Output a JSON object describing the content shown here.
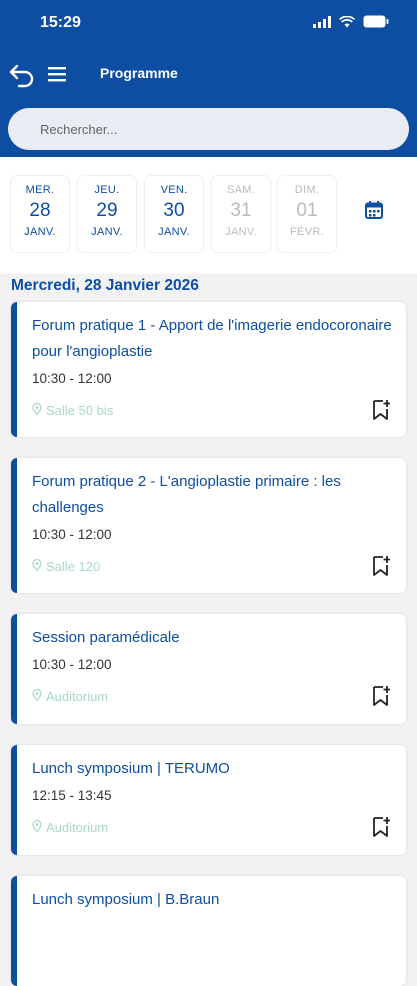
{
  "status_bar": {
    "time": "15:29"
  },
  "nav": {
    "title": "Programme"
  },
  "search": {
    "placeholder": "Rechercher..."
  },
  "days": [
    {
      "dow": "MER.",
      "num": "28",
      "mon": "JANV.",
      "enabled": true
    },
    {
      "dow": "JEU.",
      "num": "29",
      "mon": "JANV.",
      "enabled": true
    },
    {
      "dow": "VEN.",
      "num": "30",
      "mon": "JANV.",
      "enabled": true
    },
    {
      "dow": "SAM.",
      "num": "31",
      "mon": "JANV.",
      "enabled": false
    },
    {
      "dow": "DIM.",
      "num": "01",
      "mon": "FÉVR.",
      "enabled": false
    }
  ],
  "section": {
    "title": "Mercredi, 28 Janvier 2026"
  },
  "sessions": [
    {
      "title": "Forum pratique 1 - Apport de l'imagerie endocoronaire pour l'angioplastie",
      "time": "10:30 - 12:00",
      "room": "Salle 50 bis"
    },
    {
      "title": "Forum pratique 2 - L'angioplastie primaire : les challenges",
      "time": "10:30 - 12:00",
      "room": "Salle 120"
    },
    {
      "title": "Session paramédicale",
      "time": "10:30 - 12:00",
      "room": "Auditorium"
    },
    {
      "title": "Lunch symposium | TERUMO",
      "time": "12:15 - 13:45",
      "room": "Auditorium"
    },
    {
      "title": "Lunch symposium | B.Braun",
      "time": "",
      "room": ""
    }
  ],
  "colors": {
    "primary": "#0d4ea3",
    "location": "#a8d8c4",
    "disabled": "#bbbbbb"
  },
  "icons": {
    "back": "back-arrow-icon",
    "menu": "hamburger-menu-icon",
    "calendar": "calendar-icon",
    "bookmark": "bookmark-add-icon",
    "location": "location-pin-icon"
  }
}
